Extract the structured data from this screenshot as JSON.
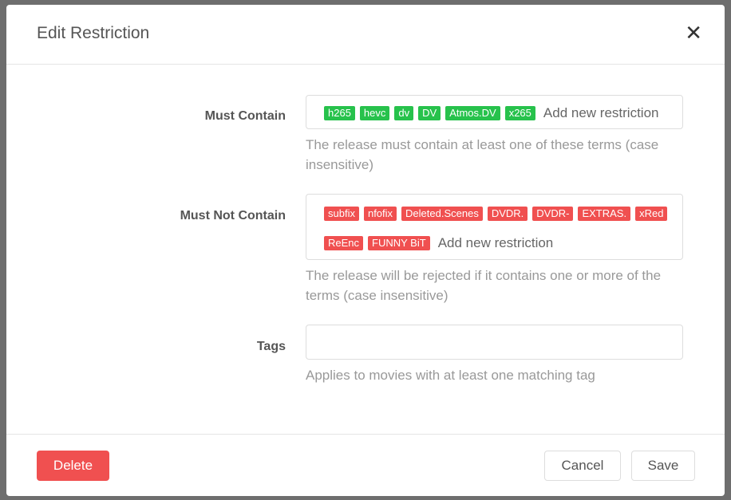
{
  "modal": {
    "title": "Edit Restriction",
    "close_icon": "close-icon"
  },
  "must_contain": {
    "label": "Must Contain",
    "tags": [
      "h265",
      "hevc",
      "dv",
      "DV",
      "Atmos.DV",
      "x265"
    ],
    "placeholder": "Add new restriction",
    "help": "The release must contain at least one of these terms (case insensitive)",
    "tag_color": "#27c24c"
  },
  "must_not_contain": {
    "label": "Must Not Contain",
    "tags": [
      "subfix",
      "nfofix",
      "Deleted.Scenes",
      "DVDR.",
      "DVDR-",
      "EXTRAS.",
      "xRed",
      "ReEnc",
      "FUNNY BiT"
    ],
    "placeholder": "Add new restriction",
    "help": "The release will be rejected if it contains one or more of the terms (case insensitive)",
    "tag_color": "#f05050"
  },
  "tags": {
    "label": "Tags",
    "value": "",
    "help": "Applies to movies with at least one matching tag"
  },
  "footer": {
    "delete": "Delete",
    "cancel": "Cancel",
    "save": "Save"
  }
}
